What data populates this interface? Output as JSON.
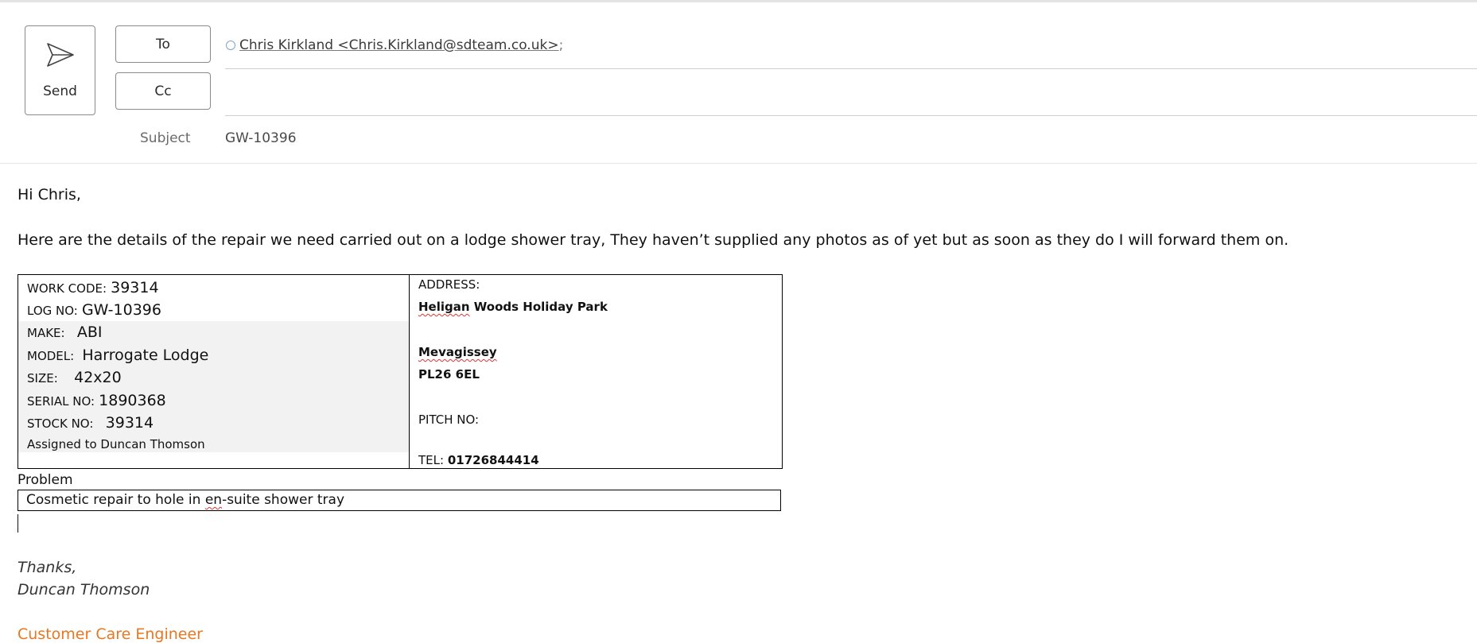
{
  "compose": {
    "send_label": "Send",
    "to_label": "To",
    "cc_label": "Cc",
    "to_recipient": "Chris Kirkland <Chris.Kirkland@sdteam.co.uk>",
    "recipient_separator": ";",
    "subject_label": "Subject",
    "subject_value": "GW-10396"
  },
  "body": {
    "greeting": "Hi Chris,",
    "intro": "Here are the details of the repair we need carried out on a lodge shower tray, They haven’t supplied any photos as of yet but as soon as they do I will forward them on.",
    "details_left": [
      {
        "key": "WORK CODE:",
        "value": "39314"
      },
      {
        "key": "LOG NO:",
        "value": "GW-10396"
      },
      {
        "key": "MAKE:",
        "value": "ABI"
      },
      {
        "key": "MODEL:",
        "value": "Harrogate Lodge"
      },
      {
        "key": "SIZE:",
        "value": "42x20"
      },
      {
        "key": "SERIAL NO:",
        "value": "1890368"
      },
      {
        "key": "STOCK NO:",
        "value": "39314"
      }
    ],
    "assigned": "Assigned to Duncan Thomson",
    "address_label": "ADDRESS:",
    "address_park_word1": "Heligan",
    "address_park_rest": " Woods Holiday Park",
    "address_town": "Mevagissey",
    "address_postcode": "PL26 6EL",
    "pitch_label": "PITCH NO:",
    "tel_label": "TEL:",
    "tel_value": "01726844414",
    "problem_label": "Problem",
    "problem_pre": "Cosmetic repair to hole in ",
    "problem_squig": "en",
    "problem_post": "-suite shower tray",
    "thanks": "Thanks,",
    "signer": "Duncan Thomson",
    "role": "Customer Care Engineer"
  },
  "colors": {
    "accent_role": "#e87722",
    "presence": "#7fa6c9"
  },
  "icons": {
    "send": "paper-plane-icon",
    "presence": "presence-circle-icon"
  }
}
